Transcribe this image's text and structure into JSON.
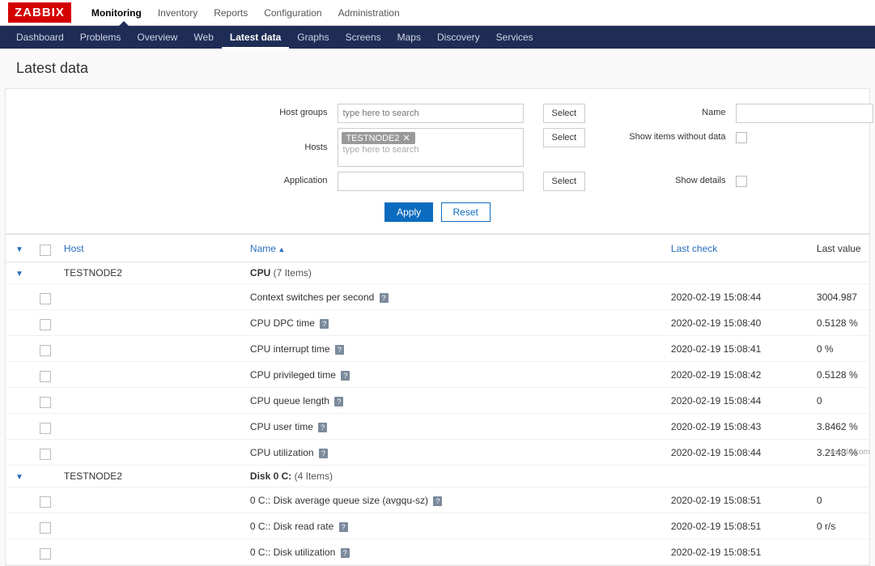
{
  "brand": "ZABBIX",
  "topnav": [
    "Monitoring",
    "Inventory",
    "Reports",
    "Configuration",
    "Administration"
  ],
  "topnav_active": 0,
  "subnav": [
    "Dashboard",
    "Problems",
    "Overview",
    "Web",
    "Latest data",
    "Graphs",
    "Screens",
    "Maps",
    "Discovery",
    "Services"
  ],
  "subnav_active": 4,
  "page_title": "Latest data",
  "filter": {
    "labels": {
      "host_groups": "Host groups",
      "hosts": "Hosts",
      "application": "Application",
      "name": "Name",
      "show_wo_data": "Show items without data",
      "show_details": "Show details"
    },
    "placeholder_search": "type here to search",
    "select_btn": "Select",
    "hosts_tags": [
      "TESTNODE2"
    ],
    "apply": "Apply",
    "reset": "Reset"
  },
  "columns": {
    "host": "Host",
    "name": "Name",
    "last_check": "Last check",
    "last_value": "Last value"
  },
  "groups": [
    {
      "host": "TESTNODE2",
      "app": "CPU",
      "count_label": "(7 Items)",
      "items": [
        {
          "name": "Context switches per second",
          "last_check": "2020-02-19 15:08:44",
          "last_value": "3004.987"
        },
        {
          "name": "CPU DPC time",
          "last_check": "2020-02-19 15:08:40",
          "last_value": "0.5128 %"
        },
        {
          "name": "CPU interrupt time",
          "last_check": "2020-02-19 15:08:41",
          "last_value": "0 %"
        },
        {
          "name": "CPU privileged time",
          "last_check": "2020-02-19 15:08:42",
          "last_value": "0.5128 %"
        },
        {
          "name": "CPU queue length",
          "last_check": "2020-02-19 15:08:44",
          "last_value": "0"
        },
        {
          "name": "CPU user time",
          "last_check": "2020-02-19 15:08:43",
          "last_value": "3.8462 %"
        },
        {
          "name": "CPU utilization",
          "last_check": "2020-02-19 15:08:44",
          "last_value": "3.2143 %"
        }
      ]
    },
    {
      "host": "TESTNODE2",
      "app": "Disk 0 C:",
      "count_label": "(4 Items)",
      "items": [
        {
          "name": "0 C:: Disk average queue size (avgqu-sz)",
          "last_check": "2020-02-19 15:08:51",
          "last_value": "0"
        },
        {
          "name": "0 C:: Disk read rate",
          "last_check": "2020-02-19 15:08:51",
          "last_value": "0 r/s"
        },
        {
          "name": "0 C:: Disk utilization",
          "last_check": "2020-02-19 15:08:51",
          "last_value": ""
        }
      ]
    }
  ],
  "footer": "wsxdn.com"
}
